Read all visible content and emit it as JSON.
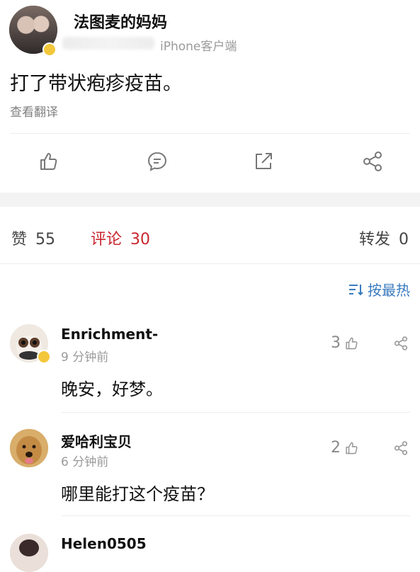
{
  "post": {
    "username": "法图麦的妈妈",
    "source": "iPhone客户端",
    "text": "打了带状疱疹疫苗。",
    "translate": "查看翻译"
  },
  "actions": {
    "icons": [
      "like-icon",
      "comment-icon",
      "repost-icon",
      "share-icon"
    ]
  },
  "stats": {
    "likes_label": "赞",
    "likes_count": "55",
    "comments_label": "评论",
    "comments_count": "30",
    "reposts_label": "转发",
    "reposts_count": "0"
  },
  "sort": {
    "label": "按最热"
  },
  "comments": [
    {
      "name": "Enrichment-",
      "time": "9 分钟前",
      "text": "晚安，好梦。",
      "likes": "3"
    },
    {
      "name": "爱哈利宝贝",
      "time": "6 分钟前",
      "text": "哪里能打这个疫苗？",
      "likes": "2"
    },
    {
      "name": "Helen0505",
      "time": "",
      "text": "",
      "likes": ""
    }
  ],
  "colors": {
    "accent_red": "#c9272f",
    "link_blue": "#3a7bbf",
    "verified_badge": "#f3c73b"
  }
}
